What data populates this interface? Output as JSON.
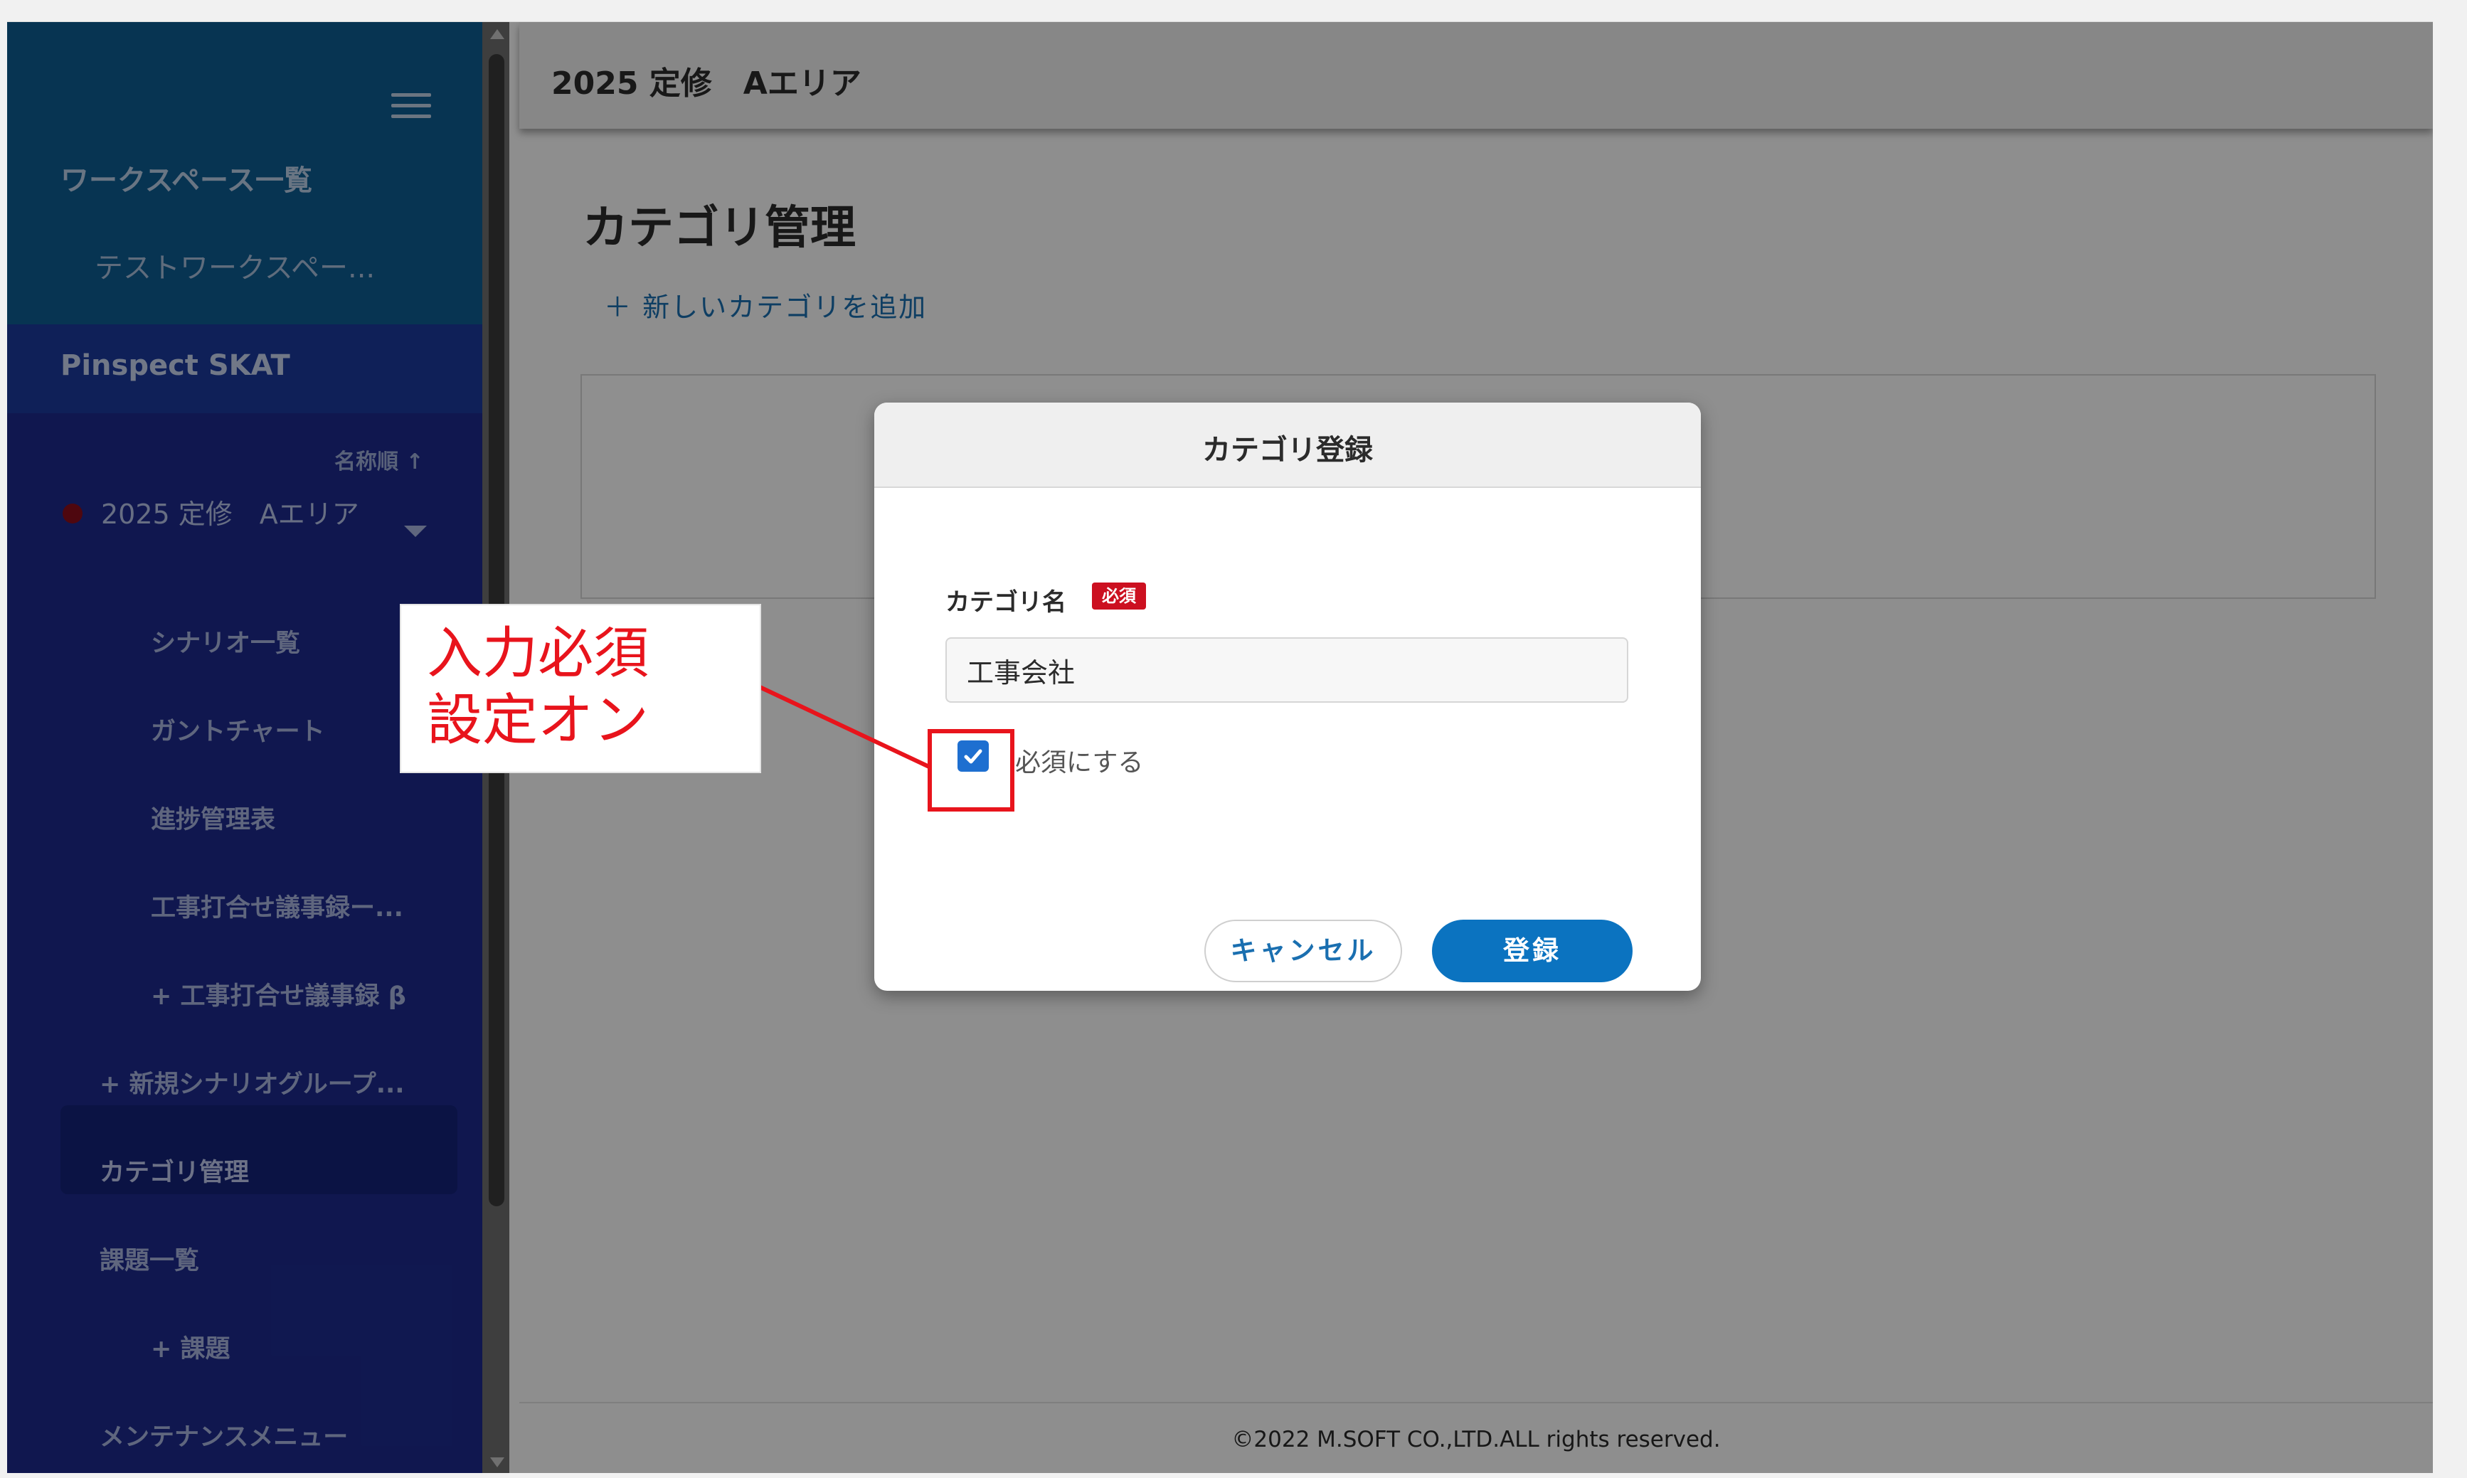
{
  "sidebar": {
    "workspace_list_title": "ワークスペース一覧",
    "workspace_item": "テストワークスペー...",
    "app_name": "Pinspect SKAT",
    "sort_label": "名称順 ↑",
    "project_name": "2025 定修　Aエリア",
    "items": [
      {
        "label": "シナリオ一覧"
      },
      {
        "label": "ガントチャート"
      },
      {
        "label": "進捗管理表"
      },
      {
        "label": "工事打合せ議事録ー..."
      },
      {
        "label": "+ 工事打合せ議事録 β"
      },
      {
        "label": "+ 新規シナリオグループ..."
      },
      {
        "label": "カテゴリ管理"
      },
      {
        "label": "課題一覧"
      },
      {
        "label": "+ 課題"
      },
      {
        "label": "メンテナンスメニュー"
      }
    ]
  },
  "header": {
    "title": "2025 定修　Aエリア"
  },
  "main": {
    "page_title": "カテゴリ管理",
    "add_category_label": "＋ 新しいカテゴリを追加"
  },
  "dialog": {
    "title": "カテゴリ登録",
    "field_label": "カテゴリ名",
    "required_badge": "必須",
    "name_value": "工事会社",
    "checkbox_label": "必須にする",
    "checkbox_checked": true,
    "cancel_label": "キャンセル",
    "submit_label": "登録"
  },
  "annotation": {
    "line1": "入力必須",
    "line2": "設定オン",
    "color": "#e8141c"
  },
  "footer": {
    "copyright": "©2022 M.SOFT CO.,LTD.ALL rights reserved."
  },
  "colors": {
    "sidebar_bg": "#1d2a8e",
    "workspace_header_bg": "#0d5d93",
    "accent_blue": "#0b73c0",
    "required_red": "#cc1020"
  },
  "icons": [
    "hamburger-icon",
    "sort-arrow-icon",
    "chevron-down-icon",
    "plus-icon",
    "check-icon"
  ]
}
